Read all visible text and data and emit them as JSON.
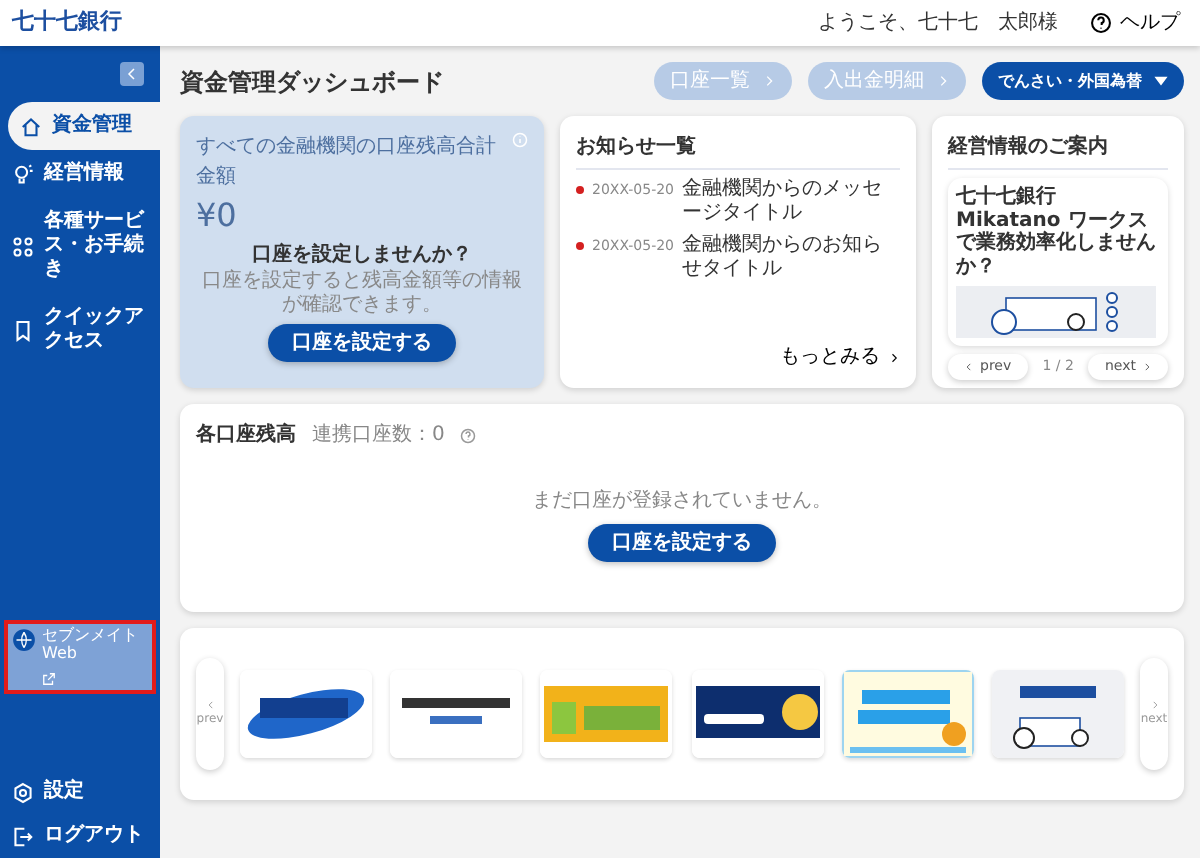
{
  "header": {
    "logo": "七十七銀行",
    "greeting": "ようこそ、七十七　太郎様",
    "help": "ヘルプ"
  },
  "sidebar": {
    "items": [
      {
        "label": "資金管理",
        "kind": "home",
        "selected": true
      },
      {
        "label": "経営情報",
        "kind": "bulb",
        "selected": false
      },
      {
        "label": "各種サービス・お手続き",
        "kind": "grid",
        "selected": false
      },
      {
        "label": "クイックアクセス",
        "kind": "bookmark",
        "selected": false
      }
    ],
    "external_link": {
      "label": "セブンメイトWeb",
      "highlighted": true
    },
    "bottom_items": [
      {
        "label": "設定",
        "kind": "gear"
      },
      {
        "label": "ログアウト",
        "kind": "logout"
      }
    ]
  },
  "page_title": "資金管理ダッシュボード",
  "toolbar": [
    {
      "label": "口座一覧",
      "kind": "link",
      "disabled": true
    },
    {
      "label": "入出金明細",
      "kind": "link",
      "disabled": true
    },
    {
      "label": "でんさい・外国為替",
      "kind": "dropdown",
      "disabled": false
    }
  ],
  "total_card": {
    "title": "すべての金融機関の口座残高合計金額",
    "amount": "¥0",
    "prompt": "口座を設定しませんか？",
    "description": "口座を設定すると残高金額等の情報が確認できます。",
    "button": "口座を設定する"
  },
  "news": {
    "title": "お知らせ一覧",
    "items": [
      {
        "date": "20XX-05-20",
        "title": "金融機関からのメッセージタイトル"
      },
      {
        "date": "20XX-05-20",
        "title": "金融機関からのお知らせタイトル"
      }
    ],
    "more": "もっとみる"
  },
  "info": {
    "title": "経営情報のご案内",
    "article_title": "七十七銀行 Mikatano ワークスで業務効率化しませんか？",
    "prev": "prev",
    "page": "1 / 2",
    "next": "next"
  },
  "balances": {
    "title": "各口座残高",
    "linked_count": "連携口座数：0",
    "empty_message": "まだ口座が登録されていません。",
    "button": "口座を設定する"
  },
  "banners": {
    "prev": "prev",
    "next": "next",
    "items": [
      {
        "kind": "densai"
      },
      {
        "kind": "letter"
      },
      {
        "kind": "etax"
      },
      {
        "kind": "chat"
      },
      {
        "kind": "startup"
      },
      {
        "kind": "mikatano"
      }
    ]
  }
}
